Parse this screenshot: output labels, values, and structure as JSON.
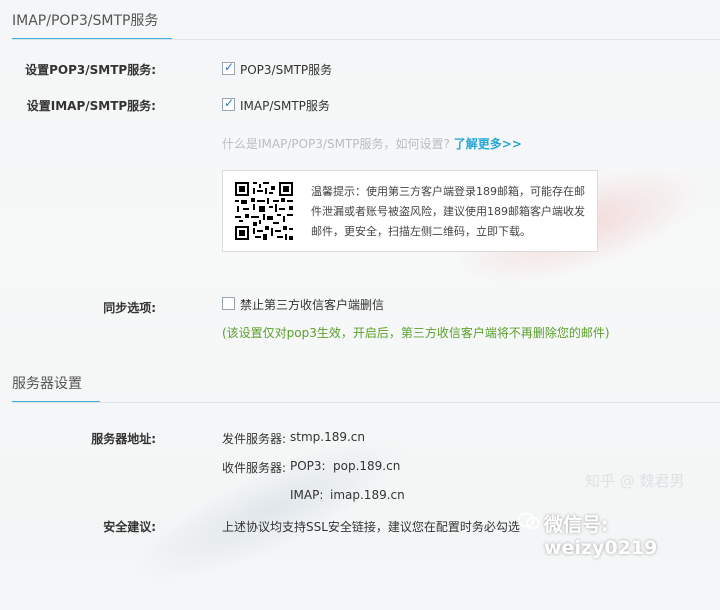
{
  "sections": {
    "imap_title": "IMAP/POP3/SMTP服务",
    "server_title": "服务器设置"
  },
  "pop3": {
    "label": "设置POP3/SMTP服务:",
    "checkbox_text": "POP3/SMTP服务",
    "checked": true
  },
  "imap": {
    "label": "设置IMAP/SMTP服务:",
    "checkbox_text": "IMAP/SMTP服务",
    "checked": true
  },
  "help": {
    "question": "什么是IMAP/POP3/SMTP服务，如何设置?",
    "link": "了解更多>>"
  },
  "tip": {
    "text": "温馨提示：使用第三方客户端登录189邮箱，可能存在邮件泄漏或者账号被盗风险，建议使用189邮箱客户端收发邮件，更安全，扫描左侧二维码，立即下载。"
  },
  "sync": {
    "label": "同步选项:",
    "checkbox_text": "禁止第三方收信客户端删信",
    "checked": false,
    "note": "(该设置仅对pop3生效，开启后，第三方收信客户端将不再删除您的邮件)"
  },
  "server": {
    "address_label": "服务器地址:",
    "send_label": "发件服务器:",
    "send_value": "stmp.189.cn",
    "recv_label": "收件服务器:",
    "pop3_label": "POP3:",
    "pop3_value": "pop.189.cn",
    "imap_label": "IMAP:",
    "imap_value": "imap.189.cn",
    "security_label": "安全建议:",
    "security_text": "上述协议均支持SSL安全链接，建议您在配置时务必勾选"
  },
  "watermark": {
    "text": "微信号: weizy0219",
    "bg_text": "知乎 @ 魏君男"
  },
  "colors": {
    "accent": "#3fb1d6",
    "link": "#2aa7d8",
    "note": "#5aa02c",
    "check": "#2f78c4"
  }
}
